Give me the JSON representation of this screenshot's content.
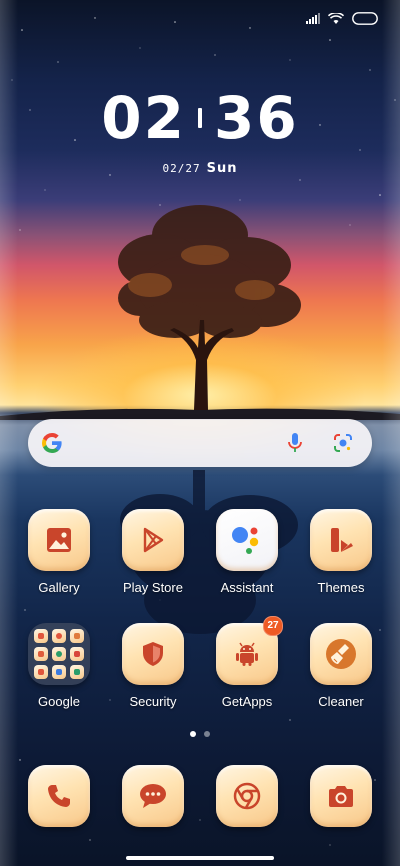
{
  "status_bar": {
    "signal_icon": "cellular-signal-icon",
    "wifi_icon": "wifi-icon",
    "battery_icon": "battery-icon"
  },
  "clock": {
    "hours": "02",
    "minutes": "36"
  },
  "date": {
    "day": "02/27",
    "weekday": "Sun"
  },
  "search_widget": {
    "logo_icon": "google-g-icon",
    "voice_icon": "microphone-icon",
    "lens_icon": "google-lens-icon"
  },
  "home_apps": [
    {
      "label": "Gallery",
      "icon": "gallery-icon"
    },
    {
      "label": "Play Store",
      "icon": "play-store-icon"
    },
    {
      "label": "Assistant",
      "icon": "assistant-icon"
    },
    {
      "label": "Themes",
      "icon": "themes-icon"
    },
    {
      "label": "Google",
      "icon": "google-folder-icon"
    },
    {
      "label": "Security",
      "icon": "security-shield-icon"
    },
    {
      "label": "GetApps",
      "icon": "android-robot-icon",
      "badge": "27"
    },
    {
      "label": "Cleaner",
      "icon": "cleaner-brush-icon"
    }
  ],
  "page_indicator": {
    "pages": 2,
    "active": 1
  },
  "dock_apps": [
    {
      "name": "Phone",
      "icon": "phone-icon"
    },
    {
      "name": "Messages",
      "icon": "messages-icon"
    },
    {
      "name": "Chrome",
      "icon": "chrome-icon"
    },
    {
      "name": "Camera",
      "icon": "camera-icon"
    }
  ],
  "colors": {
    "icon_glyph": "#c9452b",
    "badge": "#ee5a24",
    "icon_bg_light": "#fff6e4",
    "icon_bg_dark": "#f8c88a"
  }
}
